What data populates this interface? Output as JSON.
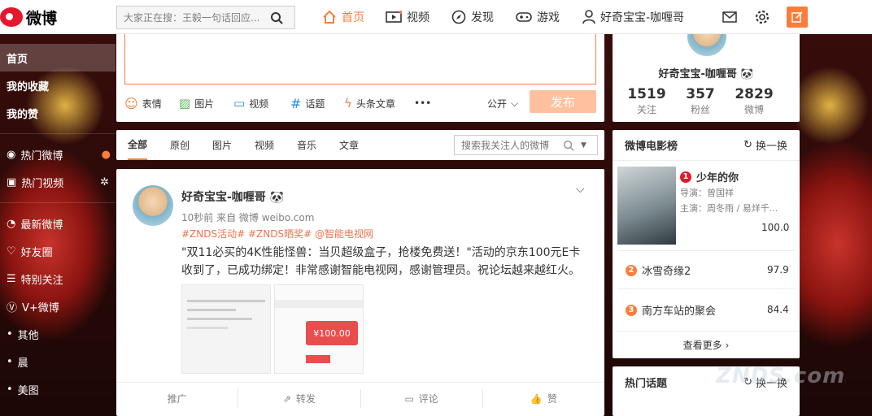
{
  "brand": {
    "name": "微博"
  },
  "search": {
    "placeholder": "大家正在搜：王毅一句话回应..."
  },
  "nav": {
    "home": "首页",
    "video": "视频",
    "discover": "发现",
    "game": "游戏",
    "user": "好奇宝宝-咖喱哥"
  },
  "sidebar": {
    "items": [
      "首页",
      "我的收藏",
      "我的赞",
      "热门微博",
      "热门视频",
      "最新微博",
      "好友圈",
      "特别关注",
      "V+微博",
      "其他",
      "晨",
      "美图"
    ]
  },
  "composer": {
    "tools": [
      "表情",
      "图片",
      "视频",
      "话题",
      "头条文章"
    ],
    "more": "•••",
    "visibility": "公开",
    "publish": "发布"
  },
  "feed": {
    "tabs": [
      "全部",
      "原创",
      "图片",
      "视频",
      "音乐",
      "文章"
    ],
    "search_placeholder": "搜索我关注人的微博"
  },
  "post": {
    "author": "好奇宝宝-咖喱哥",
    "meta": "10秒前 来自 微博 weibo.com",
    "tags": "#ZNDS活动# #ZNDS晒奖# @智能电视网",
    "text": "\"双11必买的4K性能怪兽：当贝超级盒子，抢楼免费送！\"活动的京东100元E卡收到了，已成功绑定！非常感谢智能电视网，感谢管理员。祝论坛越来越红火。",
    "thumb_amount": "¥100.00",
    "actions": [
      "推广",
      "转发",
      "评论",
      "赞"
    ]
  },
  "profile": {
    "name": "好奇宝宝-咖喱哥",
    "stats": [
      {
        "num": "1519",
        "label": "关注"
      },
      {
        "num": "357",
        "label": "粉丝"
      },
      {
        "num": "2829",
        "label": "微博"
      }
    ]
  },
  "movies": {
    "title": "微博电影榜",
    "refresh": "换一换",
    "top": {
      "rank": "1",
      "title": "少年的你",
      "director": "导演：曾国祥",
      "cast": "主演：周冬雨 / 易烊千...",
      "score": "100.0"
    },
    "items": [
      {
        "rank": "2",
        "title": "冰雪奇缘2",
        "score": "97.9"
      },
      {
        "rank": "3",
        "title": "南方车站的聚会",
        "score": "84.4"
      }
    ],
    "more": "查看更多"
  },
  "topics": {
    "title": "热门话题",
    "refresh": "换一换"
  },
  "watermark": "ZNDS.com",
  "colors": {
    "accent": "#fa7d3c",
    "link": "#eb7350",
    "rank1": "#e6162d",
    "rank23": "#fa7d3c"
  }
}
